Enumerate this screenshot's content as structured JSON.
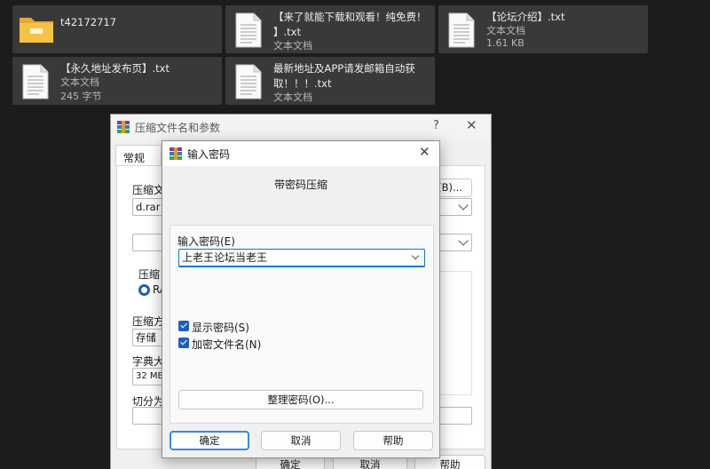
{
  "explorer": {
    "tiles": [
      {
        "name": "t42172717",
        "type": "",
        "size": "",
        "icon": "folder-icon"
      },
      {
        "name": "【来了就能下载和观看！纯免费！\n】.txt",
        "type": "文本文档",
        "size": "",
        "icon": "text-document-icon"
      },
      {
        "name": "【论坛介绍】.txt",
        "type": "文本文档",
        "size": "1.61 KB",
        "icon": "text-document-icon"
      },
      {
        "name": "【永久地址发布页】.txt",
        "type": "文本文档",
        "size": "245 字节",
        "icon": "text-document-icon"
      },
      {
        "name": "最新地址及APP请发邮箱自动获\n取！！！.txt",
        "type": "文本文档",
        "size": "",
        "icon": "text-document-icon"
      }
    ]
  },
  "archive_dialog": {
    "title": "压缩文件名和参数",
    "help": "?",
    "close": "✕",
    "tab_general": "常规",
    "archive_name_label": "压缩文",
    "browse_button": "(B)...",
    "archive_name_value": "d.rar",
    "format_label": "压缩",
    "format_option": "RA",
    "method_label": "压缩方",
    "method_value": "存储",
    "dict_label": "字典大",
    "dict_value": "32 MB",
    "split_label": "切分为",
    "ok": "确定",
    "cancel": "取消",
    "help_btn": "帮助"
  },
  "password_dialog": {
    "title": "输入密码",
    "close": "✕",
    "heading": "带密码压缩",
    "password_label": "输入密码(E)",
    "password_value": "上老王论坛当老王",
    "show_password_label": "显示密码(S)",
    "show_password_checked": true,
    "encrypt_names_label": "加密文件名(N)",
    "encrypt_names_checked": true,
    "organize_button": "整理密码(O)...",
    "ok": "确定",
    "cancel": "取消",
    "help_btn": "帮助"
  },
  "colors": {
    "accent": "#0078d4",
    "checkbox": "#1d5fb8",
    "desktop_bg": "#1c1c1c",
    "tile_bg": "#393939"
  }
}
